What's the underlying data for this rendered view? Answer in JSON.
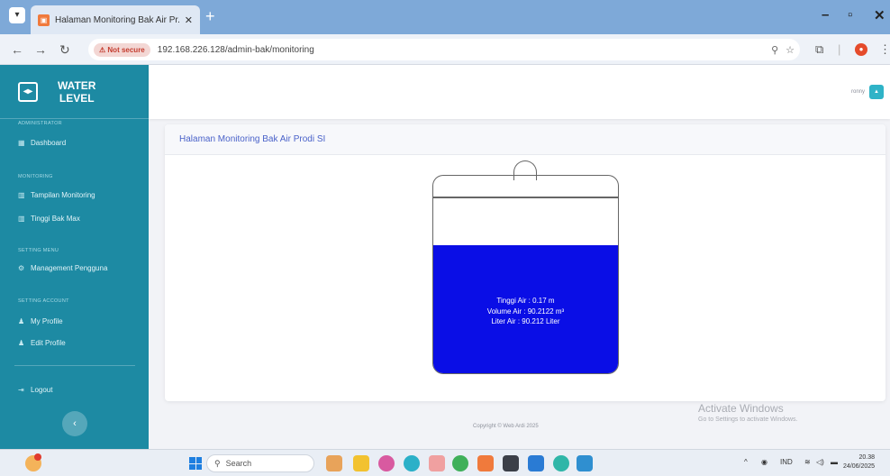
{
  "browser": {
    "tab_title": "Halaman Monitoring Bak Air Pr...",
    "address_security": "Not secure",
    "url": "192.168.226.128/admin-bak/monitoring"
  },
  "sidebar": {
    "brand_line1": "WATER",
    "brand_line2": "LEVEL",
    "sections": [
      {
        "label": "ADMINISTRATOR",
        "items": [
          {
            "label": "Dashboard",
            "icon": "dashboard-icon"
          }
        ]
      },
      {
        "label": "MONITORING",
        "items": [
          {
            "label": "Tampilan Monitoring",
            "icon": "chart-icon"
          },
          {
            "label": "Tinggi Bak Max",
            "icon": "chart-icon"
          }
        ]
      },
      {
        "label": "SETTING MENU",
        "items": [
          {
            "label": "Management Pengguna",
            "icon": "gear-icon"
          }
        ]
      },
      {
        "label": "SETTING ACCOUNT",
        "items": [
          {
            "label": "My Profile",
            "icon": "user-icon"
          },
          {
            "label": "Edit Profile",
            "icon": "user-edit-icon"
          }
        ]
      }
    ],
    "logout": "Logout"
  },
  "topbar": {
    "username": "ronny"
  },
  "main": {
    "card_title": "Halaman Monitoring Bak Air Prodi SI",
    "tank": {
      "fill_fraction": 0.72,
      "tinggi": "Tinggi Air : 0.17 m",
      "volume": "Volume Air : 90.2122 m³",
      "liter": "Liter Air : 90.212 Liter",
      "water_color": "#0a0ee6"
    }
  },
  "footer": {
    "copyright": "Copyright © Web Ardi 2025"
  },
  "watermark": {
    "line1": "Activate Windows",
    "line2": "Go to Settings to activate Windows."
  },
  "taskbar": {
    "search_label": "Search",
    "language": "IND",
    "time": "20.38",
    "date": "24/06/2025"
  },
  "colors": {
    "sidebar": "#1d8aa3",
    "accent": "#4a62c9"
  }
}
